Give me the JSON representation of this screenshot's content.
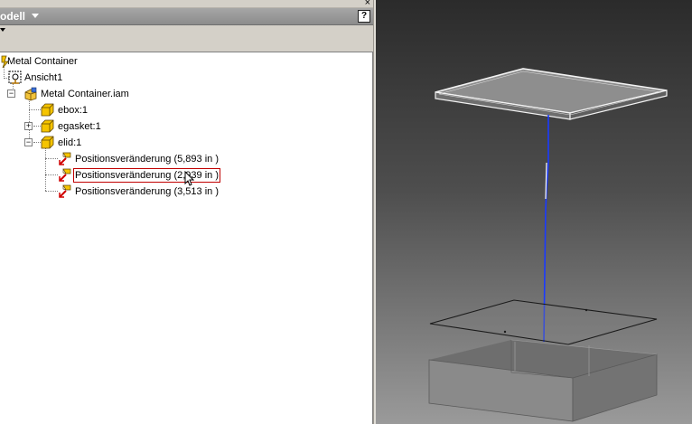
{
  "panel": {
    "title": "odell",
    "close_glyph": "×",
    "help_glyph": "?"
  },
  "tree": {
    "root_label": "Metal Container",
    "view_label": "Ansicht1",
    "assembly_label": "Metal Container.iam",
    "components": [
      {
        "label": "ebox:1",
        "expander": ""
      },
      {
        "label": "egasket:1",
        "expander": "+"
      },
      {
        "label": "elid:1",
        "expander": "−"
      }
    ],
    "position_changes": [
      {
        "label": "Positionsveränderung (5,893 in )",
        "selected": false
      },
      {
        "label": "Positionsveränderung (2,939 in )",
        "selected": true
      },
      {
        "label": "Positionsveränderung (3,513 in )",
        "selected": false
      }
    ]
  },
  "colors": {
    "panel_bg": "#d4d0c8",
    "title_bg": "#979797",
    "selection_border": "#c00000",
    "trail_line": "#1a3aff"
  },
  "icons": {
    "root": "model-root-icon",
    "view": "view-icon",
    "assembly": "assembly-icon",
    "part": "part-cube-icon",
    "tweak": "position-tweak-icon",
    "cursor": "mouse-pointer-icon"
  }
}
